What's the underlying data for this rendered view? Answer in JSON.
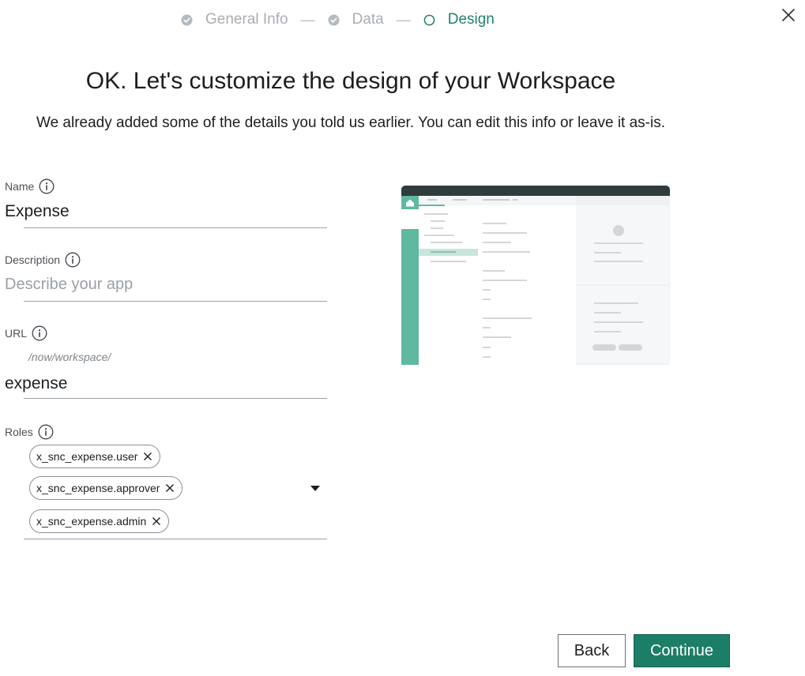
{
  "stepper": {
    "steps": [
      {
        "label": "General Info",
        "state": "complete"
      },
      {
        "label": "Data",
        "state": "complete"
      },
      {
        "label": "Design",
        "state": "current"
      }
    ],
    "separator": "—"
  },
  "header": {
    "title": "OK. Let's customize the design of your Workspace",
    "subtitle": "We already added some of the details you told us earlier. You can edit this info or leave it as-is."
  },
  "form": {
    "name": {
      "label": "Name",
      "value": "Expense"
    },
    "description": {
      "label": "Description",
      "placeholder": "Describe your app",
      "value": ""
    },
    "url": {
      "label": "URL",
      "prefix": "/now/workspace/",
      "value": "expense"
    },
    "roles": {
      "label": "Roles",
      "chips": [
        "x_snc_expense.user",
        "x_snc_expense.approver",
        "x_snc_expense.admin"
      ]
    }
  },
  "icons": {
    "close": "close-icon",
    "info": "info-icon",
    "check": "check-circle-icon",
    "current_step": "circle-outline-icon",
    "chip_remove": "close-icon",
    "dropdown": "caret-down-icon",
    "home": "home-icon"
  },
  "buttons": {
    "back": "Back",
    "continue": "Continue"
  },
  "colors": {
    "accent": "#23806d",
    "primary_button": "#1d7e68",
    "preview_header": "#2f3b3d",
    "preview_sidebar": "#5fb8a0",
    "muted_text": "#a9aeb3"
  }
}
